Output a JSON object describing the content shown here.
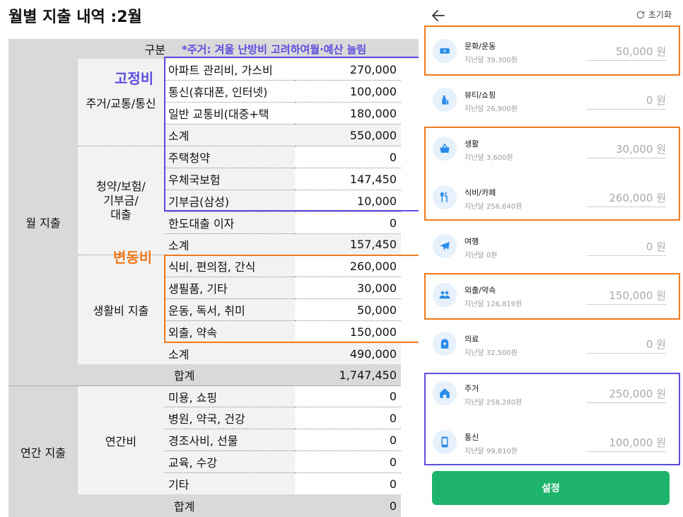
{
  "sheet": {
    "title": "월별 지출 내역 :2월",
    "header_label": "구분",
    "header_note": "*주거: 겨울 난방비 고려하여월·예산 늘림",
    "tag_fixed": "고정비",
    "tag_variable": "변동비",
    "group_monthly": "월 지출",
    "group_annual": "연간 지출",
    "sub_housing": "주거/교통/통신",
    "sub_savings": "청약/보험/\n기부금/\n대출",
    "sub_living": "생활비 지출",
    "sub_annual": "연간비",
    "rows_monthly": [
      {
        "item": "아파트 관리비, 가스비",
        "value": "270,000"
      },
      {
        "item": "통신(휴대폰, 인터넷)",
        "value": "100,000"
      },
      {
        "item": "일반 교통비(대중+택",
        "value": "180,000"
      },
      {
        "item": "소계",
        "value": "550,000"
      },
      {
        "item": "주택청약",
        "value": "0"
      },
      {
        "item": "우체국보험",
        "value": "147,450"
      },
      {
        "item": "기부금(삼성)",
        "value": "10,000"
      },
      {
        "item": "한도대출 이자",
        "value": "0"
      },
      {
        "item": "소계",
        "value": "157,450"
      },
      {
        "item": "식비, 편의점, 간식",
        "value": "260,000"
      },
      {
        "item": "생필품, 기타",
        "value": "30,000"
      },
      {
        "item": "운동, 독서, 취미",
        "value": "50,000"
      },
      {
        "item": "외출, 약속",
        "value": "150,000"
      },
      {
        "item": "소계",
        "value": "490,000"
      }
    ],
    "monthly_total": {
      "item": "합계",
      "value": "1,747,450"
    },
    "rows_annual": [
      {
        "item": "미용, 쇼핑",
        "value": "0"
      },
      {
        "item": "병원, 약국, 건강",
        "value": "0"
      },
      {
        "item": "경조사비, 선물",
        "value": "0"
      },
      {
        "item": "교육, 수강",
        "value": "0"
      },
      {
        "item": "기타",
        "value": "0"
      }
    ],
    "annual_total": {
      "item": "합계",
      "value": "0"
    }
  },
  "panel": {
    "reset_label": "초기화",
    "categories": [
      {
        "name": "문화/운동",
        "prev": "지난달 39,300원",
        "amount": "50,000 원",
        "icon": "ticket-icon"
      },
      {
        "name": "뷰티/쇼핑",
        "prev": "지난달 26,900원",
        "amount": "0 원",
        "icon": "cosmetics-icon"
      },
      {
        "name": "생활",
        "prev": "지난달 3,600원",
        "amount": "30,000 원",
        "icon": "basket-icon"
      },
      {
        "name": "식비/카페",
        "prev": "지난달 256,640원",
        "amount": "260,000 원",
        "icon": "utensils-icon"
      },
      {
        "name": "여행",
        "prev": "지난달 0원",
        "amount": "0 원",
        "icon": "airplane-icon"
      },
      {
        "name": "외출/약속",
        "prev": "지난달 126,819원",
        "amount": "150,000 원",
        "icon": "people-icon"
      },
      {
        "name": "의료",
        "prev": "지난달 32,500원",
        "amount": "0 원",
        "icon": "medical-icon"
      },
      {
        "name": "주거",
        "prev": "지난달 258,280원",
        "amount": "250,000 원",
        "icon": "house-icon"
      },
      {
        "name": "통신",
        "prev": "지난달 99,810원",
        "amount": "100,000 원",
        "icon": "phone-icon"
      }
    ],
    "submit_label": "설정"
  },
  "colors": {
    "fixed": "#5b4de0",
    "variable": "#f07a1d",
    "button": "#1db36a",
    "icon_bg": "#e6f1fb",
    "icon_fg": "#2a8ce8"
  }
}
